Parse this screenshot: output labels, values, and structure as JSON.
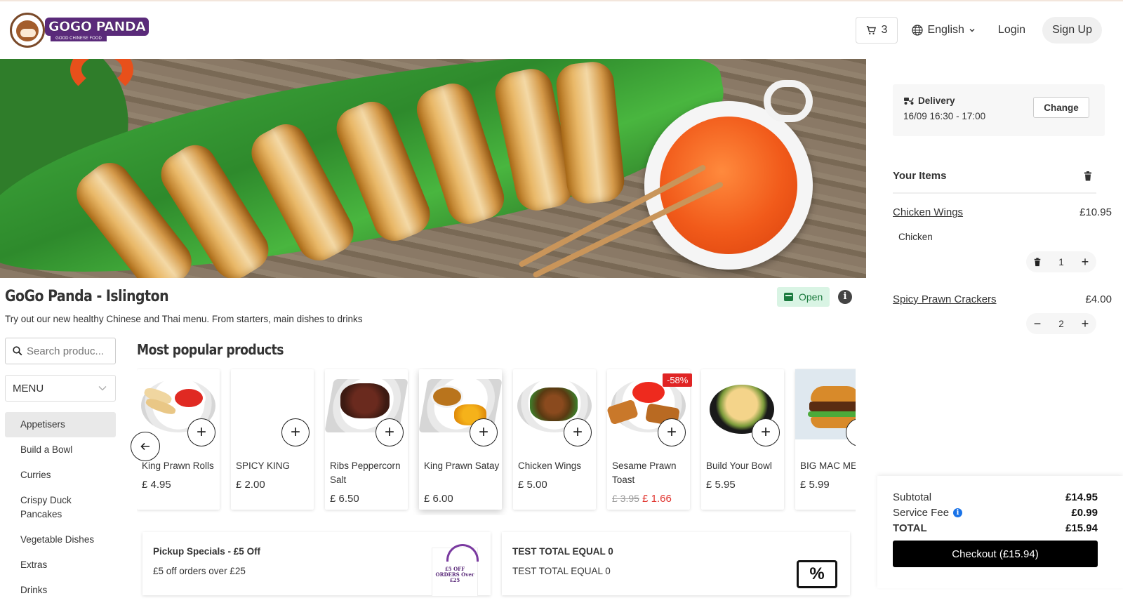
{
  "brand": {
    "logo_text": "GOGO PANDA",
    "logo_tagline": "GOOD CHINESE FOOD"
  },
  "header": {
    "cart_count": "3",
    "language": "English",
    "login": "Login",
    "signup": "Sign Up"
  },
  "store": {
    "title": "GoGo Panda - Islington",
    "description": "Try out our new healthy Chinese and Thai menu. From starters, main dishes to drinks",
    "status": "Open"
  },
  "search": {
    "placeholder": "Search produc..."
  },
  "menu": {
    "select_label": "MENU",
    "categories": [
      "Appetisers",
      "Build a Bowl",
      "Curries",
      "Crispy Duck Pancakes",
      "Vegetable Dishes",
      "Extras",
      "Drinks"
    ]
  },
  "popular": {
    "title": "Most popular products",
    "products": [
      {
        "name": "King Prawn Rolls",
        "price": "£ 4.95"
      },
      {
        "name": "SPICY KING",
        "price": "£ 2.00"
      },
      {
        "name": "Ribs Peppercorn Salt",
        "price": "£ 6.50"
      },
      {
        "name": "King Prawn Satay",
        "price": "£ 6.00"
      },
      {
        "name": "Chicken Wings",
        "price": "£ 5.00"
      },
      {
        "name": "Sesame Prawn Toast",
        "old_price": "£ 3.95",
        "price": "£ 1.66",
        "discount": "-58%"
      },
      {
        "name": "Build Your Bowl",
        "price": "£ 5.95"
      },
      {
        "name": "BIG MAC ME",
        "price": "£ 5.99"
      }
    ]
  },
  "promos": [
    {
      "title": "Pickup Specials - £5 Off",
      "desc": "£5 off orders over £25",
      "image_text": "£5 OFF ORDERS Over £25"
    },
    {
      "title": "TEST TOTAL EQUAL 0",
      "desc": "TEST TOTAL EQUAL 0",
      "image_text": "%"
    }
  ],
  "order": {
    "mode": "Delivery",
    "slot": "16/09 16:30 - 17:00",
    "change": "Change",
    "items_title": "Your Items",
    "items": [
      {
        "name": "Chicken Wings",
        "price": "£10.95",
        "option": "Chicken",
        "qty": "1"
      },
      {
        "name": "Spicy Prawn Crackers",
        "price": "£4.00",
        "qty": "2"
      }
    ],
    "subtotal_label": "Subtotal",
    "subtotal": "£14.95",
    "fee_label": "Service Fee",
    "fee": "£0.99",
    "total_label": "TOTAL",
    "total": "£15.94",
    "checkout": "Checkout (£15.94)"
  },
  "colors": {
    "accent": "#000000",
    "open_bg": "#d9f4e4",
    "open_fg": "#1b7a3e",
    "discount": "#e02424",
    "brand": "#5a2a7a"
  }
}
